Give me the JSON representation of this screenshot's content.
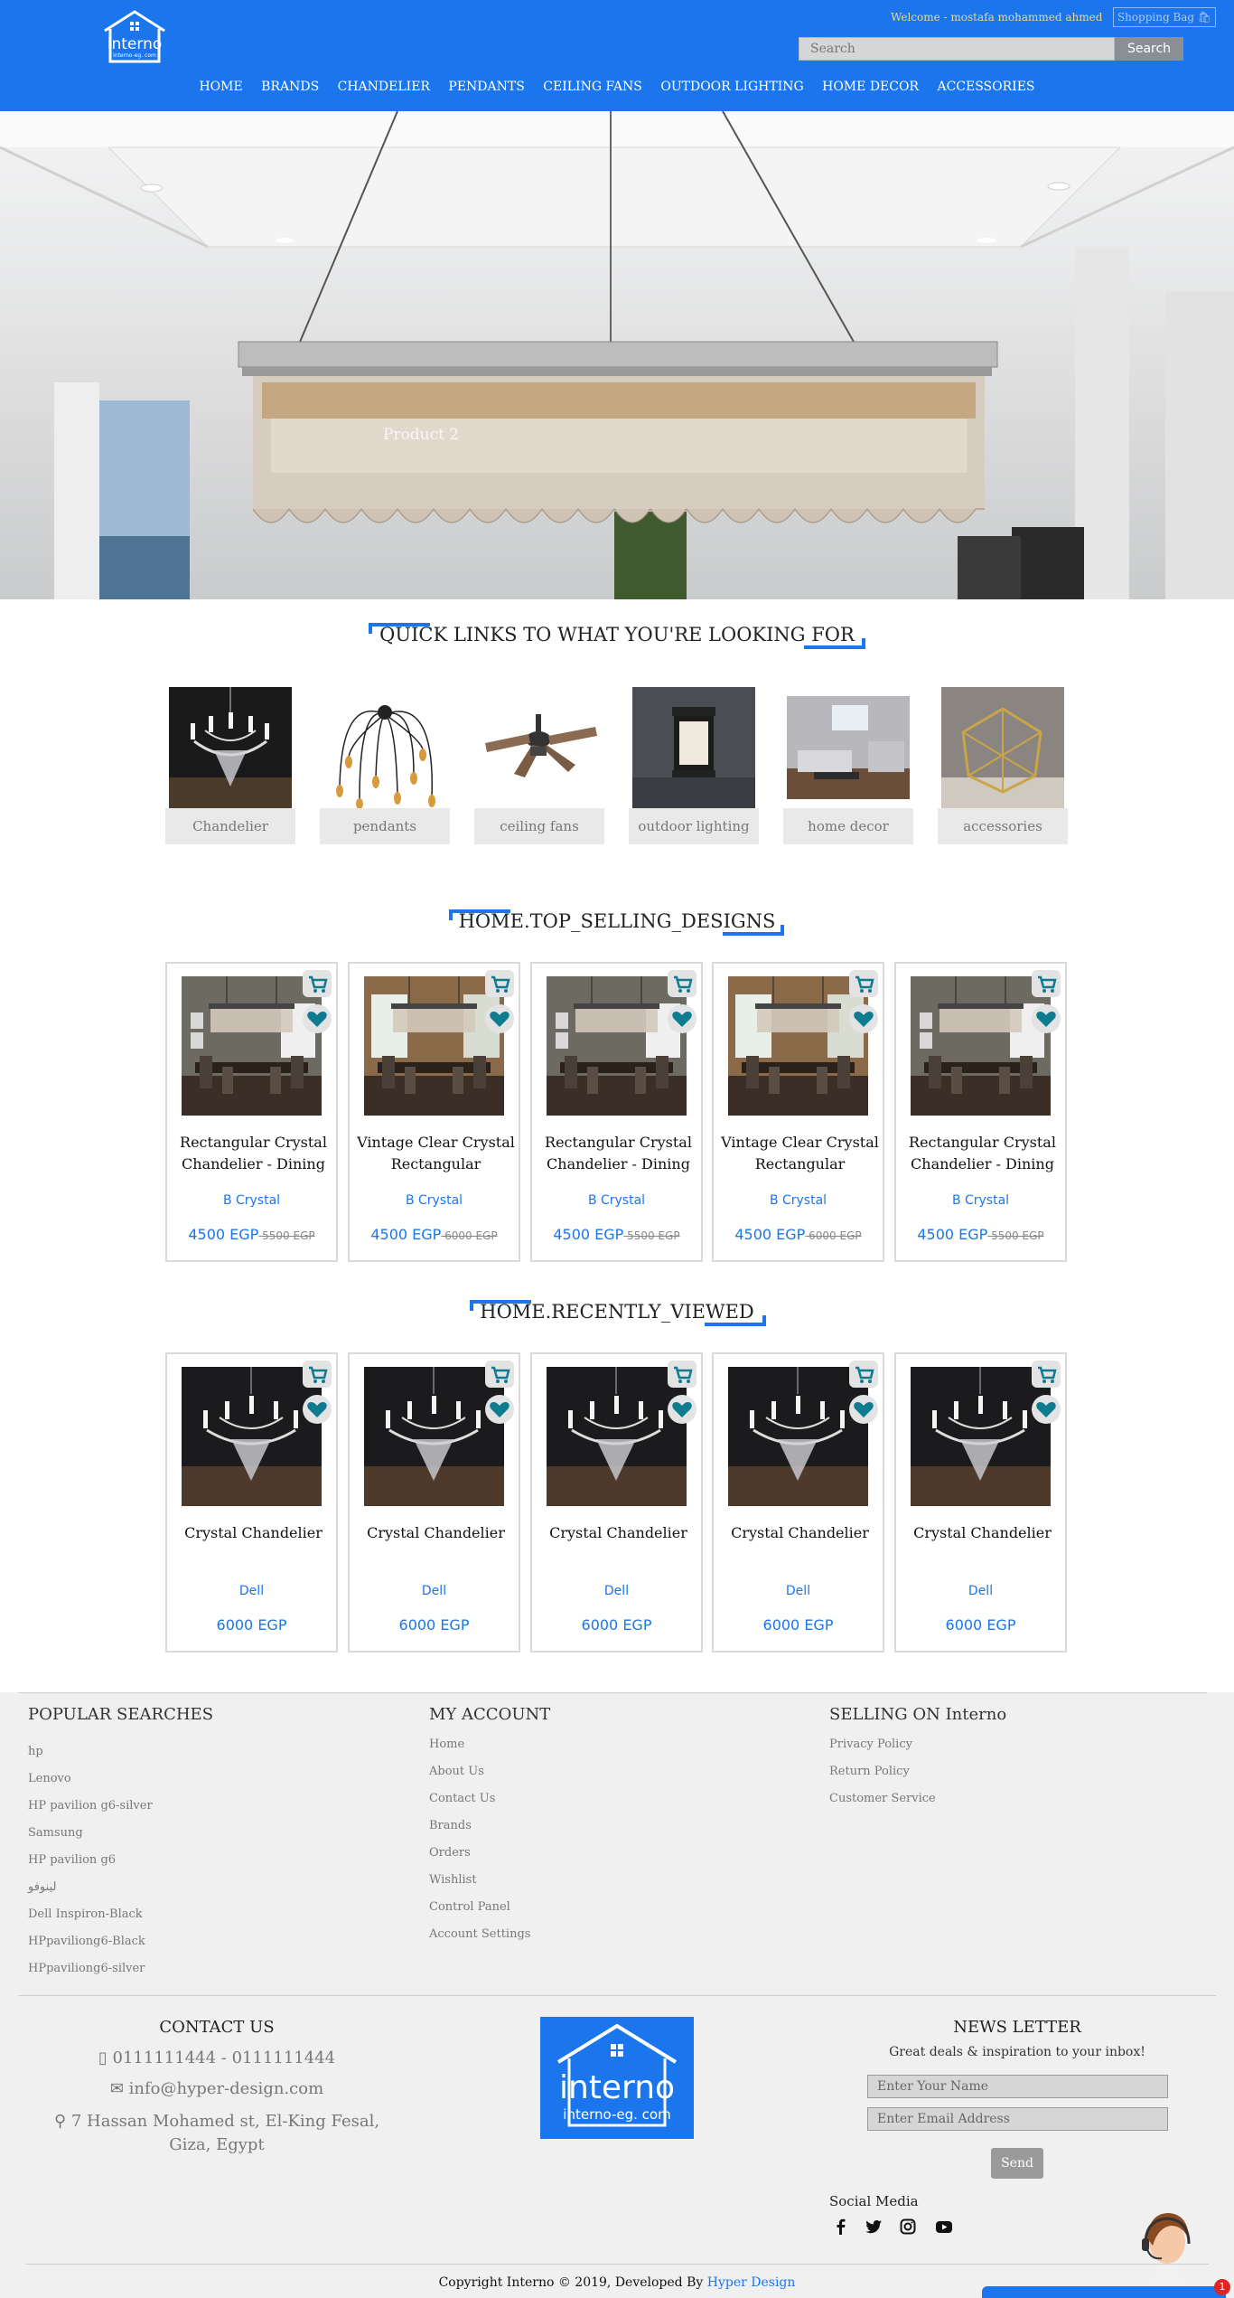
{
  "header": {
    "logo_text": "interno",
    "logo_sub": "interno-eg. com",
    "welcome": "Welcome - mostafa mohammed ahmed",
    "bag_label": "Shopping Bag 🛍",
    "search_placeholder": "Search",
    "search_button": "Search",
    "nav": [
      "HOME",
      "BRANDS",
      "CHANDELIER",
      "PENDANTS",
      "CEILING FANS",
      "OUTDOOR LIGHTING",
      "HOME DECOR",
      "ACCESSORIES"
    ]
  },
  "hero": {
    "label": "Product 2"
  },
  "quick_links": {
    "title": "QUICK LINKS TO WHAT YOU'RE LOOKING FOR",
    "items": [
      {
        "label": "Chandelier",
        "icon": "chandelier-image"
      },
      {
        "label": "pendants",
        "icon": "pendants-image"
      },
      {
        "label": "ceiling fans",
        "icon": "ceiling-fan-image"
      },
      {
        "label": "outdoor lighting",
        "icon": "outdoor-light-image"
      },
      {
        "label": "home decor",
        "icon": "home-decor-image"
      },
      {
        "label": "accessories",
        "icon": "accessories-image"
      }
    ]
  },
  "top_selling": {
    "title": "HOME.TOP_SELLING_DESIGNS",
    "products": [
      {
        "title": "Rectangular Crystal Chandelier - Dining Room",
        "brand": "B Crystal",
        "price": "4500 EGP",
        "old_price": "5500 EGP",
        "image": "dining-chandelier-a"
      },
      {
        "title": "Vintage Clear Crystal Rectangular Chandelier",
        "brand": "B Crystal",
        "price": "4500 EGP",
        "old_price": "6000 EGP",
        "image": "dining-chandelier-b"
      },
      {
        "title": "Rectangular Crystal Chandelier - Dining Room",
        "brand": "B Crystal",
        "price": "4500 EGP",
        "old_price": "5500 EGP",
        "image": "dining-chandelier-a"
      },
      {
        "title": "Vintage Clear Crystal Rectangular Chandelier",
        "brand": "B Crystal",
        "price": "4500 EGP",
        "old_price": "6000 EGP",
        "image": "dining-chandelier-b"
      },
      {
        "title": "Rectangular Crystal Chandelier - Dining Room",
        "brand": "B Crystal",
        "price": "4500 EGP",
        "old_price": "5500 EGP",
        "image": "dining-chandelier-a"
      }
    ]
  },
  "recently_viewed": {
    "title": "HOME.RECENTLY_VIEWED",
    "products": [
      {
        "title": "Crystal Chandelier",
        "brand": "Dell",
        "price": "6000 EGP",
        "old_price": ""
      },
      {
        "title": "Crystal Chandelier",
        "brand": "Dell",
        "price": "6000 EGP",
        "old_price": ""
      },
      {
        "title": "Crystal Chandelier",
        "brand": "Dell",
        "price": "6000 EGP",
        "old_price": ""
      },
      {
        "title": "Crystal Chandelier",
        "brand": "Dell",
        "price": "6000 EGP",
        "old_price": ""
      },
      {
        "title": "Crystal Chandelier",
        "brand": "Dell",
        "price": "6000 EGP",
        "old_price": ""
      }
    ]
  },
  "footer": {
    "popular": {
      "title": "POPULAR SEARCHES",
      "links": [
        "hp",
        "Lenovo",
        "HP pavilion g6-silver",
        "Samsung",
        "HP pavilion g6",
        "لينوفو",
        "Dell Inspiron-Black",
        "HPpaviliong6-Black",
        "HPpaviliong6-silver"
      ]
    },
    "account": {
      "title": "MY ACCOUNT",
      "links": [
        "Home",
        "About Us",
        "Contact Us",
        "Brands",
        "Orders",
        "Wishlist",
        "Control Panel",
        "Account Settings"
      ]
    },
    "selling": {
      "title": "SELLING ON Interno",
      "links": [
        "Privacy Policy",
        "Return Policy",
        "Customer Service"
      ]
    },
    "contact": {
      "title": "CONTACT US",
      "phone": "0111111444 - 0111111444",
      "email": "info@hyper-design.com",
      "address": "7 Hassan Mohamed st, El-King Fesal, Giza, Egypt"
    },
    "newsletter": {
      "title": "NEWS LETTER",
      "subtitle": "Great deals & inspiration to your inbox!",
      "name_placeholder": "Enter Your Name",
      "email_placeholder": "Enter Email Address",
      "send": "Send"
    },
    "social_title": "Social Media",
    "social_icons": [
      "facebook-icon",
      "twitter-icon",
      "instagram-icon",
      "youtube-icon"
    ],
    "copyright": "Copyright Interno © 2019, Developed By ",
    "developer": "Hyper Design",
    "chat_badge": "1"
  },
  "colors": {
    "brand": "#1b76ee",
    "footer_bg": "#f0f0f0",
    "teal_icon": "#0f7b90"
  }
}
